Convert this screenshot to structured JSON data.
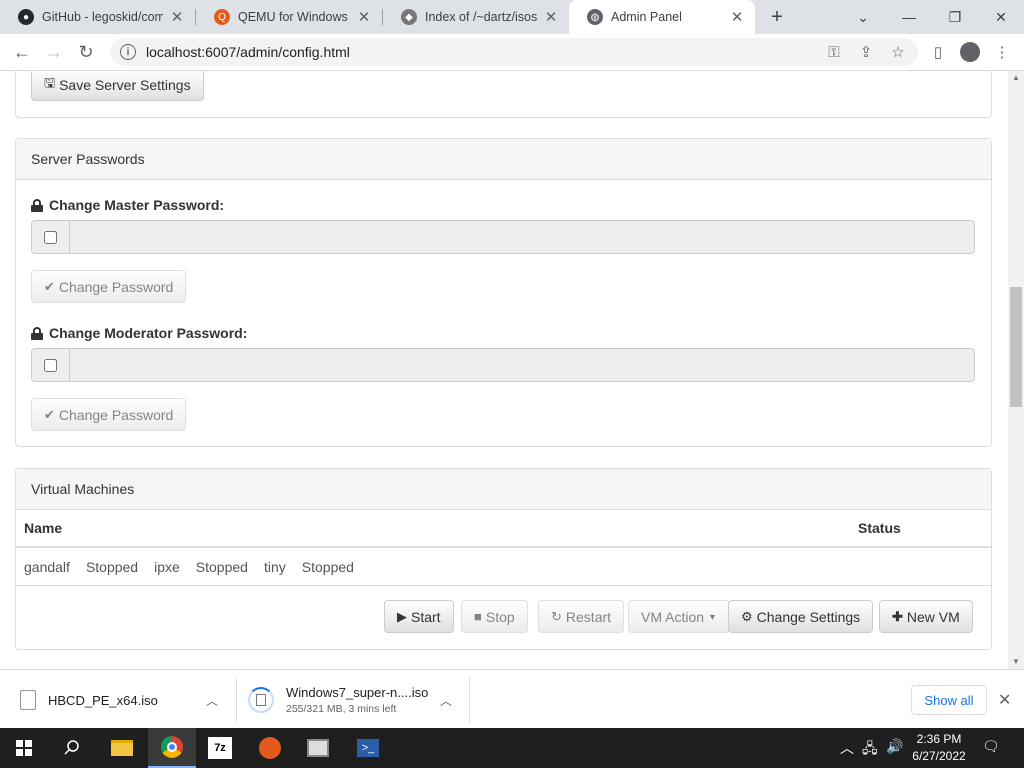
{
  "browser": {
    "tabs": [
      {
        "title": "GitHub - legoskid/com",
        "favicon": "github-icon"
      },
      {
        "title": "QEMU for Windows – I",
        "favicon": "qemu-icon"
      },
      {
        "title": "Index of /~dartz/isos/",
        "favicon": "apache-icon"
      },
      {
        "title": "Admin Panel",
        "favicon": "globe-icon",
        "active": true
      }
    ],
    "url": "localhost:6007/admin/config.html"
  },
  "page": {
    "save_settings_label": "Save Server Settings",
    "passwords_panel": {
      "heading": "Server Passwords",
      "master_label": "Change Master Password:",
      "master_button": "Change Password",
      "moderator_label": "Change Moderator Password:",
      "moderator_button": "Change Password"
    },
    "vm_panel": {
      "heading": "Virtual Machines",
      "columns": {
        "name": "Name",
        "status": "Status"
      },
      "rows": [
        "gandalf",
        "Stopped",
        "ipxe",
        "Stopped",
        "tiny",
        "Stopped"
      ],
      "actions": {
        "start": "Start",
        "stop": "Stop",
        "restart": "Restart",
        "vm_action": "VM Action",
        "change_settings": "Change Settings",
        "new_vm": "New VM"
      }
    }
  },
  "downloads": {
    "items": [
      {
        "name": "HBCD_PE_x64.iso"
      },
      {
        "name": "Windows7_super-n....iso",
        "status": "255/321 MB, 3 mins left"
      }
    ],
    "show_all": "Show all"
  },
  "taskbar": {
    "time": "2:36 PM",
    "date": "6/27/2022"
  },
  "colors": {
    "link_blue": "#1a73e8",
    "panel_heading_bg": "#f5f5f5",
    "taskbar_bg": "#1f1f1f"
  }
}
